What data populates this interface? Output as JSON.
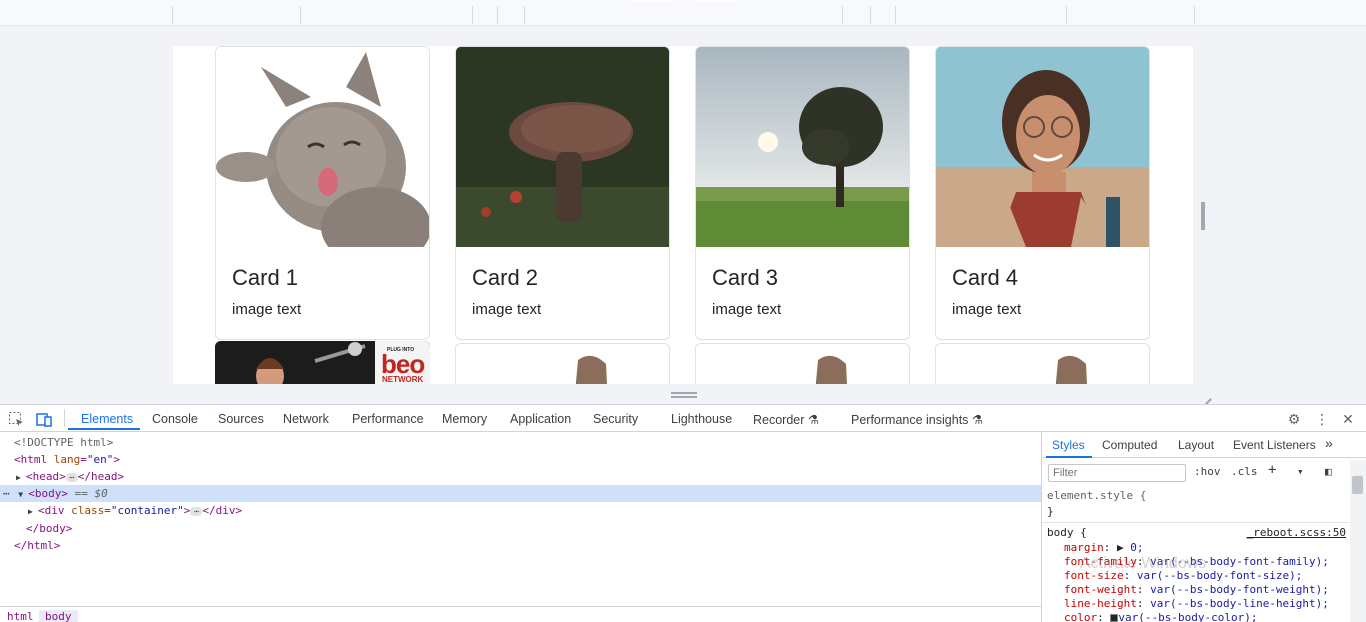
{
  "cards": [
    {
      "title": "Card 1",
      "text": "image text",
      "image": "cat-image"
    },
    {
      "title": "Card 2",
      "text": "image text",
      "image": "mushroom-image"
    },
    {
      "title": "Card 3",
      "text": "image text",
      "image": "tree-image"
    },
    {
      "title": "Card 4",
      "text": "image text",
      "image": "woman-image"
    }
  ],
  "second_row_logo": {
    "tagline": "PLUG INTO",
    "brand": "beo",
    "sub": "NETWORK"
  },
  "devtools": {
    "tabs": [
      "Elements",
      "Console",
      "Sources",
      "Network",
      "Performance",
      "Memory",
      "Application",
      "Security",
      "Lighthouse",
      "Recorder",
      "Performance insights"
    ],
    "active_tab": "Elements",
    "dom": {
      "doctype": "<!DOCTYPE html>",
      "html_open": "<html",
      "html_attr": "lang",
      "html_attr_val": "\"en\"",
      "head_open": "<head>",
      "head_close": "</head>",
      "body_open": "<body>",
      "body_ref": "== $0",
      "div_open": "<div",
      "div_attr": "class",
      "div_attr_val": "\"container\"",
      "div_close": "</div>",
      "body_close": "</body>",
      "html_close": "</html>"
    },
    "breadcrumb": [
      "html",
      "body"
    ],
    "styles_tabs": [
      "Styles",
      "Computed",
      "Layout",
      "Event Listeners"
    ],
    "filter_placeholder": "Filter",
    "controls": {
      "hov": ":hov",
      "cls": ".cls"
    },
    "rules": {
      "element_style": "element.style {",
      "close": "}",
      "body_selector": "body {",
      "source": "_reboot.scss:50",
      "props": [
        {
          "name": "margin",
          "value": "0;"
        },
        {
          "name": "font-family",
          "value": "var(--bs-body-font-family);"
        },
        {
          "name": "font-size",
          "value": "var(--bs-body-font-size);"
        },
        {
          "name": "font-weight",
          "value": "var(--bs-body-font-weight);"
        },
        {
          "name": "line-height",
          "value": "var(--bs-body-line-height);"
        },
        {
          "name": "color",
          "value": "var(--bs-body-color);"
        }
      ]
    },
    "watermark": "Activate Windows"
  }
}
